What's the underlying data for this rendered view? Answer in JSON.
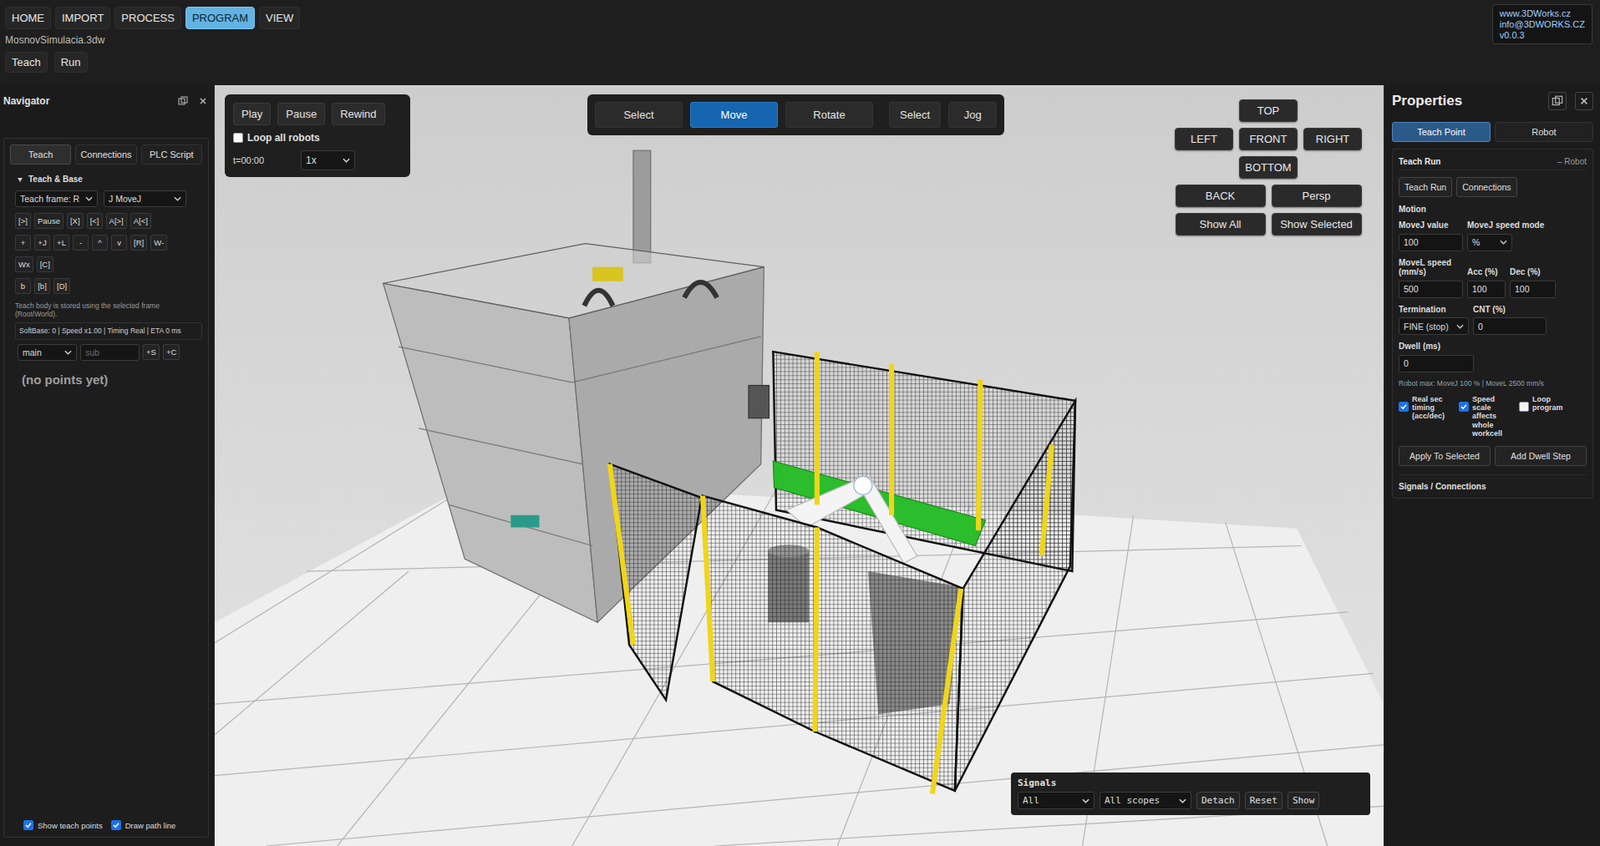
{
  "menu": [
    {
      "label": "HOME",
      "selected": false
    },
    {
      "label": "IMPORT",
      "selected": false
    },
    {
      "label": "PROCESS",
      "selected": false
    },
    {
      "label": "PROGRAM",
      "selected": true
    },
    {
      "label": "VIEW",
      "selected": false
    }
  ],
  "brand": [
    "www.3DWorks.cz",
    "info@3DWORKS.CZ",
    "v0.0.3"
  ],
  "file": "MosnovSimulacia.3dw",
  "modes": [
    "Teach",
    "Run"
  ],
  "navigator": {
    "title": "Navigator",
    "tabs": [
      {
        "label": "Teach",
        "selected": true
      },
      {
        "label": "Connections",
        "selected": false
      },
      {
        "label": "PLC Script",
        "selected": false
      }
    ],
    "section": {
      "label": "Teach & Base",
      "expanded": true
    },
    "frame_select": "Teach frame: R",
    "move_select": "J MoveJ",
    "tool_rows": [
      [
        "[>]",
        "Pause",
        "[X]",
        "[<]",
        "A[>]",
        "A[<]"
      ],
      [
        "+",
        "+J",
        "+L",
        "-",
        "^",
        "v",
        "[R]",
        "W-"
      ],
      [
        "Wx",
        "[C]"
      ],
      [
        "b",
        "[b]",
        "[D]"
      ]
    ],
    "hint": "Teach body is stored using the selected frame (Root/World).",
    "status": "SoftBase: 0 | Speed x1.00 | Timing Real | ETA 0 ms",
    "program_select": "main",
    "sub_placeholder": "sub",
    "sub_buttons": [
      "+S",
      "+C"
    ],
    "empty": "(no points yet)",
    "footer": [
      {
        "label": "Show teach points",
        "checked": true
      },
      {
        "label": "Draw path line",
        "checked": true
      }
    ]
  },
  "playback": {
    "buttons": [
      "Play",
      "Pause",
      "Rewind"
    ],
    "loop": {
      "label": "Loop all robots",
      "checked": false
    },
    "time": "t=00:00",
    "speed": "1x"
  },
  "toolbar": [
    {
      "label": "Select",
      "selected": false,
      "group": 1
    },
    {
      "label": "Move",
      "selected": true,
      "group": 1
    },
    {
      "label": "Rotate",
      "selected": false,
      "group": 1
    },
    {
      "label": "Select",
      "selected": false,
      "group": 2
    },
    {
      "label": "Jog",
      "selected": false,
      "group": 2
    }
  ],
  "views": [
    [
      "TOP"
    ],
    [
      "LEFT",
      "FRONT",
      "RIGHT"
    ],
    [
      "BOTTOM"
    ],
    [
      "BACK",
      "Persp"
    ],
    [
      "Show All",
      "Show Selected"
    ]
  ],
  "signals": {
    "title": "Signals",
    "filters": [
      "All",
      "All scopes"
    ],
    "buttons": [
      "Detach",
      "Reset",
      "Show"
    ]
  },
  "properties": {
    "title": "Properties",
    "tabs": [
      {
        "label": "Teach Point",
        "selected": true
      },
      {
        "label": "Robot",
        "selected": false
      }
    ],
    "card_title": "Teach Run",
    "card_robot": "– Robot",
    "card_buttons": [
      "Teach Run",
      "Connections"
    ],
    "motion": "Motion",
    "movej_value": {
      "label": "MoveJ value",
      "value": "100"
    },
    "movej_mode": {
      "label": "MoveJ speed mode",
      "value": "%"
    },
    "movel_speed": {
      "label": "MoveL speed (mm/s)",
      "value": "500"
    },
    "acc": {
      "label": "Acc (%)",
      "value": "100"
    },
    "dec": {
      "label": "Dec (%)",
      "value": "100"
    },
    "termination": {
      "label": "Termination",
      "value": "FINE (stop)"
    },
    "cnt": {
      "label": "CNT (%)",
      "value": "0"
    },
    "dwell": {
      "label": "Dwell (ms)",
      "value": "0"
    },
    "note": "Robot max: MoveJ 100 % | MoveL 2500 mm/s",
    "options": [
      {
        "label": "Real sec timing (acc/dec)",
        "checked": true
      },
      {
        "label": "Speed scale affects whole workcell",
        "checked": true
      },
      {
        "label": "Loop program",
        "checked": false
      }
    ],
    "actions": [
      "Apply To Selected",
      "Add Dwell Step"
    ],
    "signals_section": "Signals / Connections"
  }
}
